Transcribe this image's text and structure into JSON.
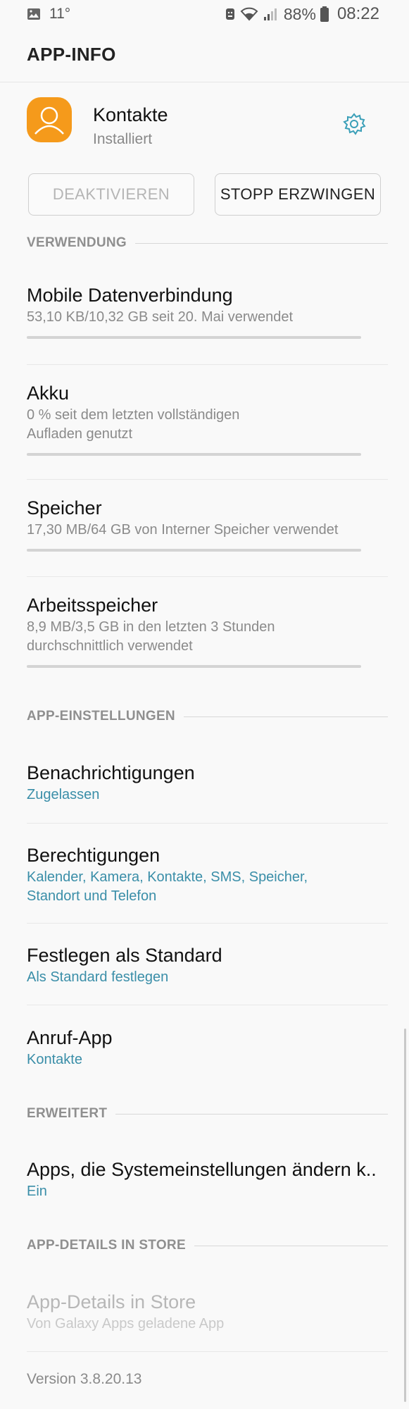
{
  "status_bar": {
    "temperature": "11°",
    "battery_percent": "88%",
    "time": "08:22",
    "icons": [
      "image-icon",
      "android-icon",
      "wifi-icon",
      "signal-icon",
      "battery-icon"
    ]
  },
  "header": {
    "title": "APP-INFO"
  },
  "app": {
    "name": "Kontakte",
    "status": "Installiert",
    "icon": "contacts-person-icon",
    "icon_color": "#f59a1b"
  },
  "buttons": {
    "deactivate": "DEAKTIVIEREN",
    "force_stop": "STOPP ERZWINGEN"
  },
  "sections": {
    "usage": "VERWENDUNG",
    "app_settings": "APP-EINSTELLUNGEN",
    "advanced": "ERWEITERT",
    "store": "APP-DETAILS IN STORE"
  },
  "usage_items": [
    {
      "title": "Mobile Datenverbindung",
      "sub1": "53,10 KB/10,32 GB seit 20. Mai verwendet",
      "sub2": ""
    },
    {
      "title": "Akku",
      "sub1": "0 % seit dem letzten vollständigen",
      "sub2": "Aufladen genutzt"
    },
    {
      "title": "Speicher",
      "sub1": "17,30 MB/64 GB von Interner Speicher verwendet",
      "sub2": ""
    },
    {
      "title": "Arbeitsspeicher",
      "sub1": "8,9 MB/3,5 GB in den letzten 3 Stunden",
      "sub2": "durchschnittlich verwendet"
    }
  ],
  "settings_items": [
    {
      "title": "Benachrichtigungen",
      "sub1": "Zugelassen",
      "sub2": ""
    },
    {
      "title": "Berechtigungen",
      "sub1": "Kalender, Kamera, Kontakte, SMS, Speicher,",
      "sub2": "Standort und Telefon"
    },
    {
      "title": "Festlegen als Standard",
      "sub1": "Als Standard festlegen",
      "sub2": ""
    },
    {
      "title": "Anruf-App",
      "sub1": "Kontakte",
      "sub2": ""
    }
  ],
  "advanced_item": {
    "title": "Apps, die Systemeinstellungen ändern k..",
    "sub": "Ein"
  },
  "store_item": {
    "title": "App-Details in Store",
    "sub": "Von Galaxy Apps geladene App"
  },
  "version": "Version 3.8.20.13",
  "colors": {
    "accent": "#3a8ea8",
    "app_icon": "#f59a1b"
  }
}
